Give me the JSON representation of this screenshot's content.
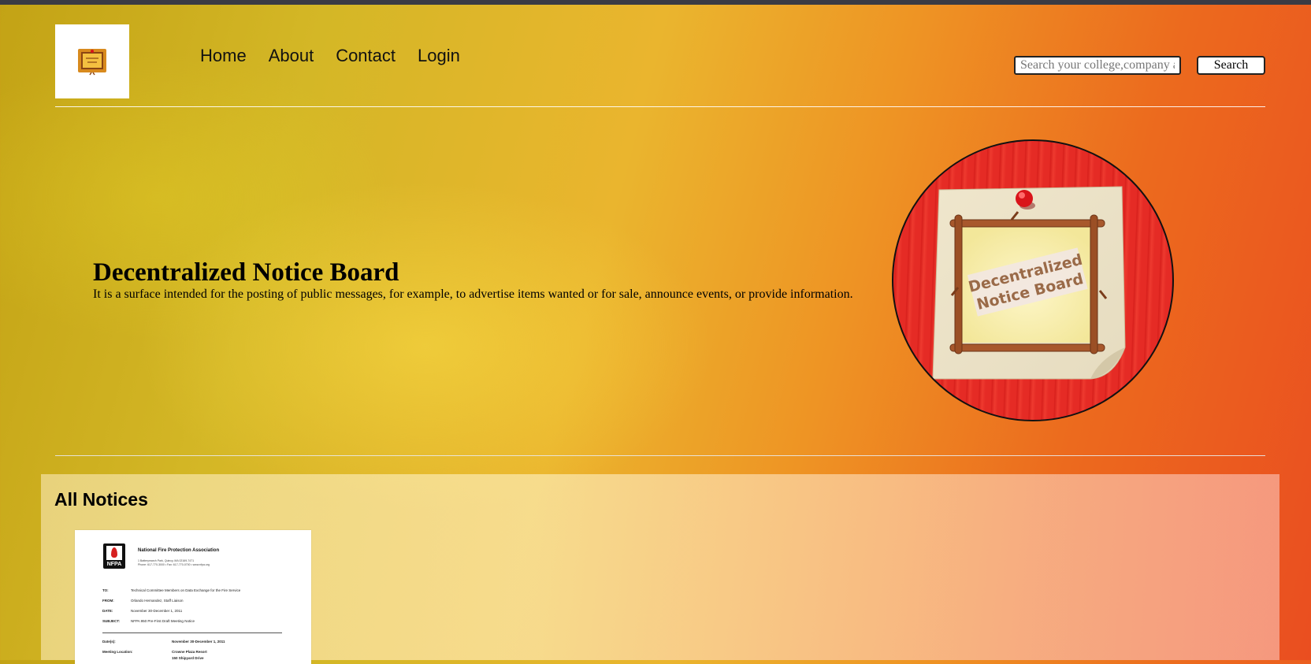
{
  "header": {
    "logo_alt": "Decentralized Notice Board logo",
    "nav": [
      {
        "label": "Home"
      },
      {
        "label": "About"
      },
      {
        "label": "Contact"
      },
      {
        "label": "Login"
      }
    ],
    "search": {
      "placeholder": "Search your college,company a",
      "button_label": "Search"
    }
  },
  "hero": {
    "title": "Decentralized Notice Board",
    "description": "It is a surface intended for the posting of public messages, for example, to advertise items wanted or for sale, announce events, or provide information.",
    "image_caption_line1": "Decentralized",
    "image_caption_line2": "Notice Board"
  },
  "notices": {
    "title": "All Notices",
    "items": [
      {
        "logo_text": "NFPA",
        "org": "National Fire Protection Association",
        "address_line1": "1 Batterymarch Park, Quincy, MA 02169-7471",
        "address_line2": "Phone: 617-770-3000 • Fax: 617-770-0700 • www.nfpa.org",
        "fields": [
          {
            "key": "TO:",
            "value": "Technical Committee Members on Data Exchange for the Fire Service"
          },
          {
            "key": "FROM:",
            "value": "Orlando Hernandez, Staff Liaison"
          },
          {
            "key": "DATE:",
            "value": "November 30-December 1, 2011"
          },
          {
            "key": "SUBJECT:",
            "value": "NFPA 950 Pre-First Draft Meeting Notice"
          }
        ],
        "details": [
          {
            "key": "Date(s):",
            "value": "November 30-December 1, 2011"
          },
          {
            "key": "Meeting Location:",
            "value": "Crowne Plaza Resort"
          },
          {
            "key": "",
            "value": "150 Shipyard Drive"
          }
        ]
      }
    ]
  },
  "colors": {
    "topbar": "#3a3b44",
    "accent_circle": "#e52b25",
    "pin": "#d9141a",
    "frame_wood": "#a0522d"
  }
}
